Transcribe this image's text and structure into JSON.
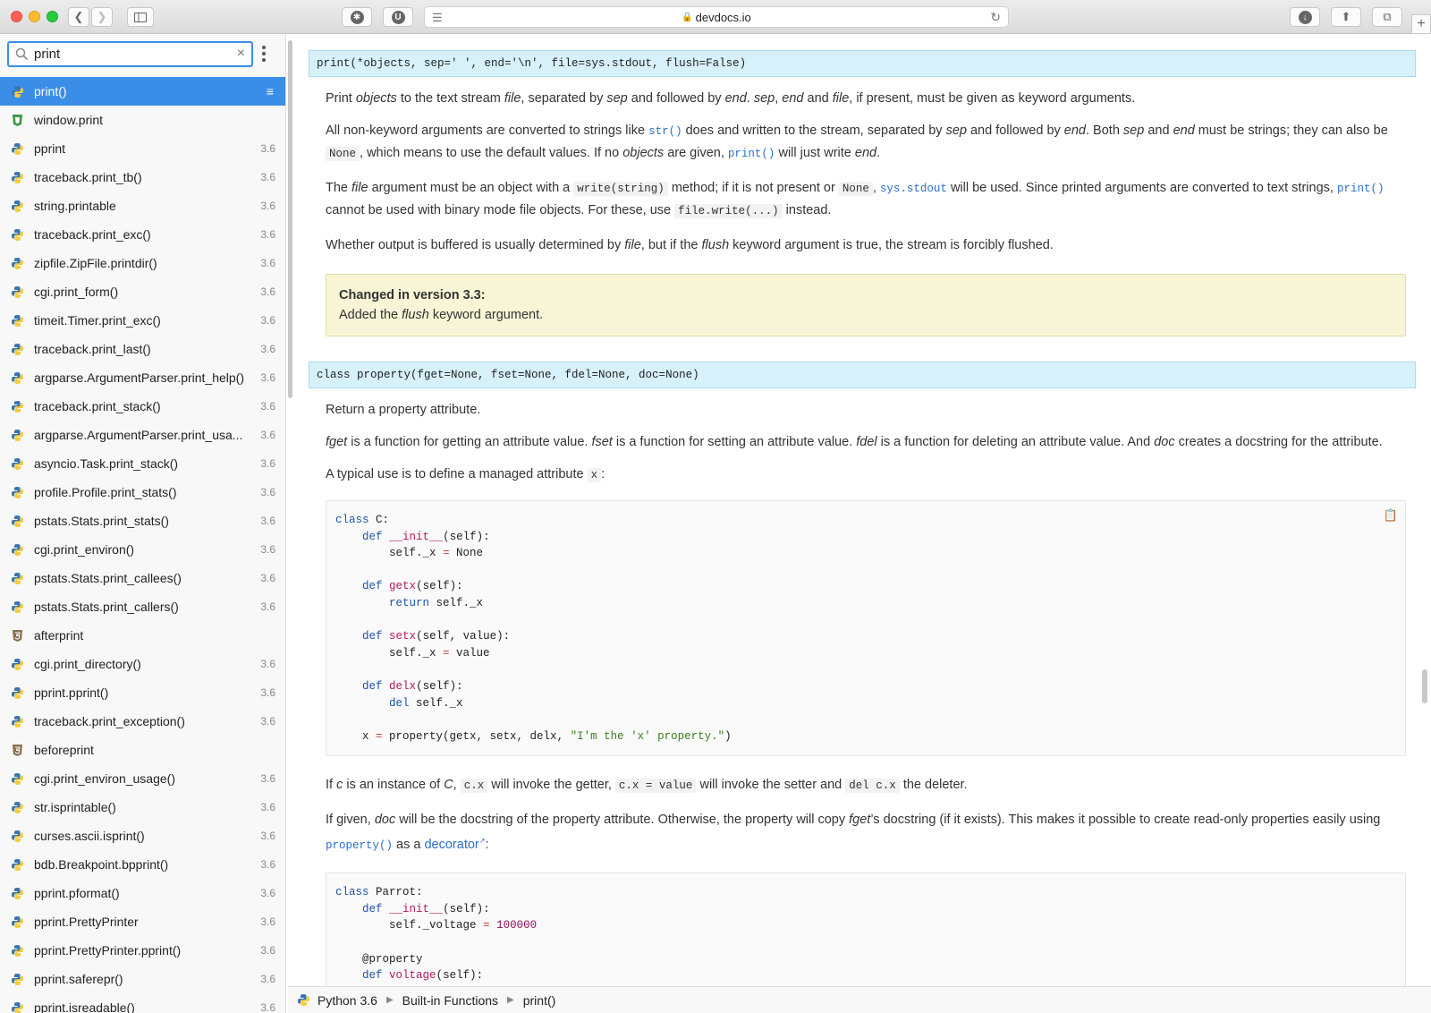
{
  "browser": {
    "url": "devdocs.io"
  },
  "search": {
    "value": "print"
  },
  "sidebar": {
    "items": [
      {
        "label": "print()",
        "version": "",
        "icon": "python-icon",
        "active": true
      },
      {
        "label": "window.print",
        "version": "",
        "icon": "shield-icon"
      },
      {
        "label": "pprint",
        "version": "3.6",
        "icon": "python-icon"
      },
      {
        "label": "traceback.print_tb()",
        "version": "3.6",
        "icon": "python-icon"
      },
      {
        "label": "string.printable",
        "version": "3.6",
        "icon": "python-icon"
      },
      {
        "label": "traceback.print_exc()",
        "version": "3.6",
        "icon": "python-icon"
      },
      {
        "label": "zipfile.ZipFile.printdir()",
        "version": "3.6",
        "icon": "python-icon"
      },
      {
        "label": "cgi.print_form()",
        "version": "3.6",
        "icon": "python-icon"
      },
      {
        "label": "timeit.Timer.print_exc()",
        "version": "3.6",
        "icon": "python-icon"
      },
      {
        "label": "traceback.print_last()",
        "version": "3.6",
        "icon": "python-icon"
      },
      {
        "label": "argparse.ArgumentParser.print_help()",
        "version": "3.6",
        "icon": "python-icon"
      },
      {
        "label": "traceback.print_stack()",
        "version": "3.6",
        "icon": "python-icon"
      },
      {
        "label": "argparse.ArgumentParser.print_usa...",
        "version": "3.6",
        "icon": "python-icon"
      },
      {
        "label": "asyncio.Task.print_stack()",
        "version": "3.6",
        "icon": "python-icon"
      },
      {
        "label": "profile.Profile.print_stats()",
        "version": "3.6",
        "icon": "python-icon"
      },
      {
        "label": "pstats.Stats.print_stats()",
        "version": "3.6",
        "icon": "python-icon"
      },
      {
        "label": "cgi.print_environ()",
        "version": "3.6",
        "icon": "python-icon"
      },
      {
        "label": "pstats.Stats.print_callees()",
        "version": "3.6",
        "icon": "python-icon"
      },
      {
        "label": "pstats.Stats.print_callers()",
        "version": "3.6",
        "icon": "python-icon"
      },
      {
        "label": "afterprint",
        "version": "",
        "icon": "html5-icon"
      },
      {
        "label": "cgi.print_directory()",
        "version": "3.6",
        "icon": "python-icon"
      },
      {
        "label": "pprint.pprint()",
        "version": "3.6",
        "icon": "python-icon"
      },
      {
        "label": "traceback.print_exception()",
        "version": "3.6",
        "icon": "python-icon"
      },
      {
        "label": "beforeprint",
        "version": "",
        "icon": "html5-icon"
      },
      {
        "label": "cgi.print_environ_usage()",
        "version": "3.6",
        "icon": "python-icon"
      },
      {
        "label": "str.isprintable()",
        "version": "3.6",
        "icon": "python-icon"
      },
      {
        "label": "curses.ascii.isprint()",
        "version": "3.6",
        "icon": "python-icon"
      },
      {
        "label": "bdb.Breakpoint.bpprint()",
        "version": "3.6",
        "icon": "python-icon"
      },
      {
        "label": "pprint.pformat()",
        "version": "3.6",
        "icon": "python-icon"
      },
      {
        "label": "pprint.PrettyPrinter",
        "version": "3.6",
        "icon": "python-icon"
      },
      {
        "label": "pprint.PrettyPrinter.pprint()",
        "version": "3.6",
        "icon": "python-icon"
      },
      {
        "label": "pprint.saferepr()",
        "version": "3.6",
        "icon": "python-icon"
      },
      {
        "label": "pprint.isreadable()",
        "version": "3.6",
        "icon": "python-icon"
      }
    ]
  },
  "doc": {
    "print_signature": "print(*objects, sep=' ', end='\\n', file=sys.stdout, flush=False)",
    "property_signature": "class property(fget=None, fset=None, fdel=None, doc=None)",
    "note_title": "Changed in version 3.3:",
    "note_body_pre": "Added the ",
    "note_body_em": "flush",
    "note_body_post": " keyword argument.",
    "return_text": "Return a property attribute.",
    "typical_use": "A typical use is to define a managed attribute "
  },
  "footer": {
    "crumbs": [
      "Python 3.6",
      "Built-in Functions",
      "print()"
    ]
  },
  "colors": {
    "accent": "#3b8ee8",
    "signature_bg": "#d7f1fb",
    "note_bg": "#f7f5d6"
  }
}
